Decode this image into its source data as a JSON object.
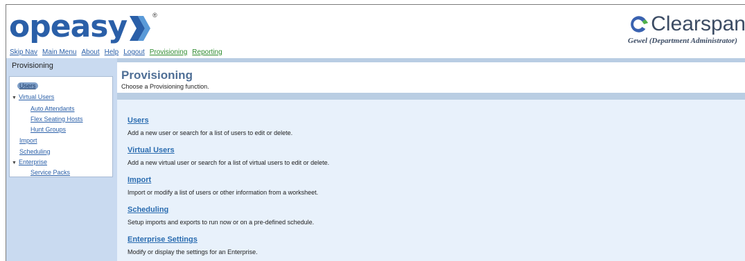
{
  "header": {
    "logo_text": "opeasy",
    "logo_mark": "®",
    "brand_name": "Clearspan",
    "user_role": "Gewel (Department Administrator)"
  },
  "topnav": [
    {
      "label": "Skip Nav"
    },
    {
      "label": "Main Menu"
    },
    {
      "label": "About"
    },
    {
      "label": "Help"
    },
    {
      "label": "Logout"
    },
    {
      "label": "Provisioning"
    },
    {
      "label": "Reporting"
    }
  ],
  "sidebar": {
    "title": "Provisioning",
    "items": [
      {
        "label": "Users"
      },
      {
        "label": "Virtual Users"
      },
      {
        "label": "Auto Attendants"
      },
      {
        "label": "Flex Seating Hosts"
      },
      {
        "label": "Hunt Groups"
      },
      {
        "label": "Import"
      },
      {
        "label": "Scheduling"
      },
      {
        "label": "Enterprise"
      },
      {
        "label": "Service Packs"
      }
    ]
  },
  "main": {
    "title": "Provisioning",
    "subtitle": "Choose a Provisioning function.",
    "functions": [
      {
        "title": "Users",
        "description": "Add a new user or search for a list of users to edit or delete."
      },
      {
        "title": "Virtual Users",
        "description": "Add a new virtual user or search for a list of virtual users to edit or delete."
      },
      {
        "title": "Import",
        "description": "Import or modify a list of users or other information from a worksheet."
      },
      {
        "title": "Scheduling",
        "description": "Setup imports and exports to run now or on a pre-defined schedule."
      },
      {
        "title": "Enterprise Settings",
        "description": "Modify or display the settings for an Enterprise."
      }
    ]
  },
  "colors": {
    "link_blue": "#2a5fa8",
    "link_green": "#2e8b2e",
    "title_blue": "#4f6f96",
    "sidebar_bg": "#c9daf0",
    "content_bg": "#e8f1fb"
  }
}
